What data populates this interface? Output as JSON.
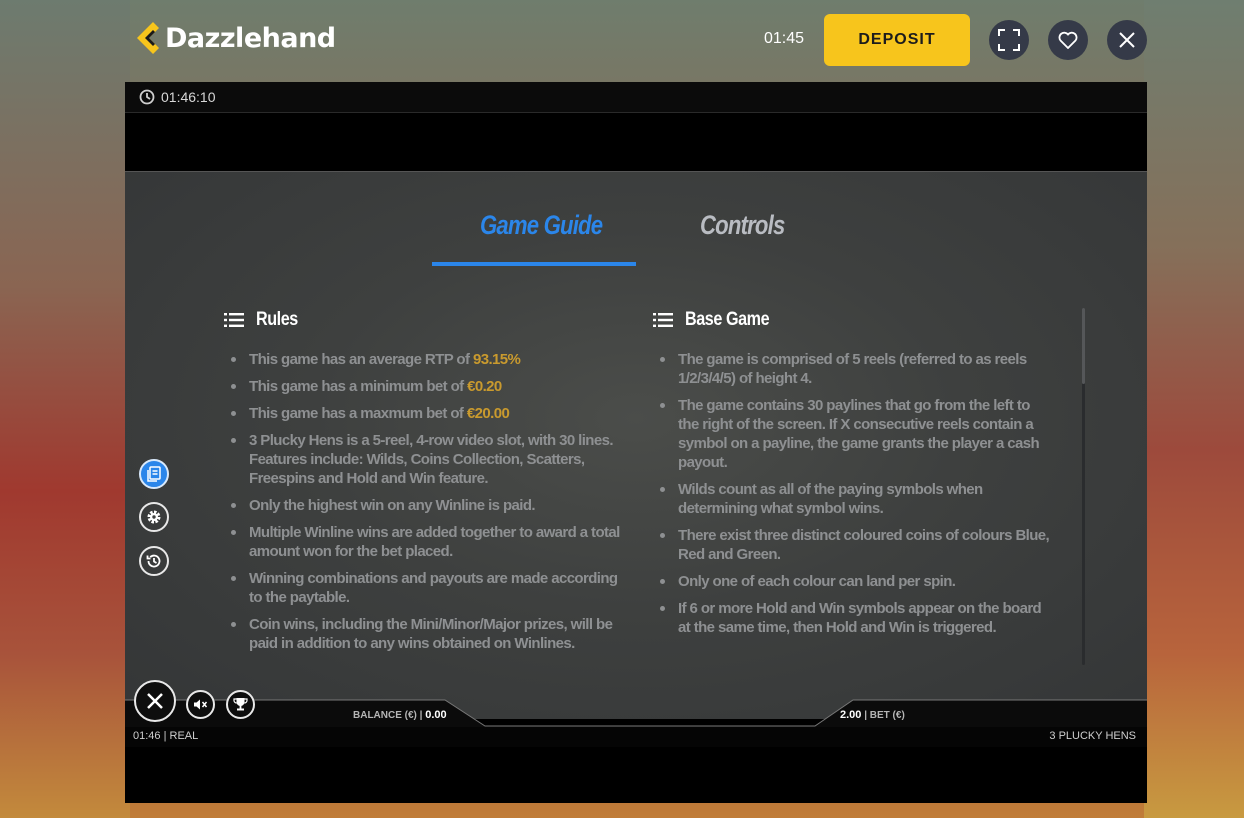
{
  "header": {
    "logo_text": "Dazzlehand",
    "time": "01:45",
    "deposit_label": "DEPOSIT"
  },
  "game": {
    "session_timer": "01:46:10",
    "tabs": [
      {
        "label": "Game Guide",
        "active": true
      },
      {
        "label": "Controls",
        "active": false
      }
    ],
    "rules": {
      "title": "Rules",
      "items": [
        {
          "text": "This game has an average RTP of ",
          "value": "93.15%"
        },
        {
          "text": "This game has a minimum bet of ",
          "value": "€0.20"
        },
        {
          "text": "This game has a maxmum bet of ",
          "value": "€20.00"
        },
        {
          "text": "3 Plucky Hens is a 5-reel, 4-row video slot, with 30 lines. Features include: Wilds, Coins Collection, Scatters, Freespins and Hold and Win feature."
        },
        {
          "text": "Only the highest win on any Winline is paid."
        },
        {
          "text": "Multiple Winline wins are added together to award a total amount won for the bet placed."
        },
        {
          "text": "Winning combinations and payouts are made according to the paytable."
        },
        {
          "text": "Coin wins, including the Mini/Minor/Major prizes, will be paid in addition to any wins obtained on Winlines."
        }
      ]
    },
    "base_game": {
      "title": "Base Game",
      "items": [
        "The game is comprised of 5 reels (referred to as reels 1/2/3/4/5) of height 4.",
        "The game contains 30 paylines that go from the left to the right of the screen. If X consecutive reels contain a symbol on a payline, the game grants the player a cash payout.",
        "Wilds count as all of the paying symbols when determining what symbol wins.",
        "There exist three distinct coloured coins of colours Blue, Red and Green.",
        "Only one of each colour can land per spin.",
        "If 6 or more Hold and Win symbols appear on the board at the same time, then Hold and Win is triggered."
      ]
    },
    "hud": {
      "balance_label": "BALANCE (€) |",
      "balance_value": "0.00",
      "bet_value": "2.00",
      "bet_label": "| BET (€)"
    },
    "footer": {
      "left": "01:46 | REAL",
      "right": "3 PLUCKY HENS"
    },
    "scroll_position": 0.0
  },
  "colors": {
    "accent_blue": "#2b86ea",
    "deposit_yellow": "#f7c51c",
    "highlight_gold": "#c99a2e"
  },
  "icons": [
    "menu-list-icon",
    "paytable-icon",
    "settings-gear-icon",
    "history-icon",
    "close-icon",
    "mute-icon",
    "trophy-icon",
    "fullscreen-icon",
    "heart-icon",
    "clock-icon"
  ]
}
